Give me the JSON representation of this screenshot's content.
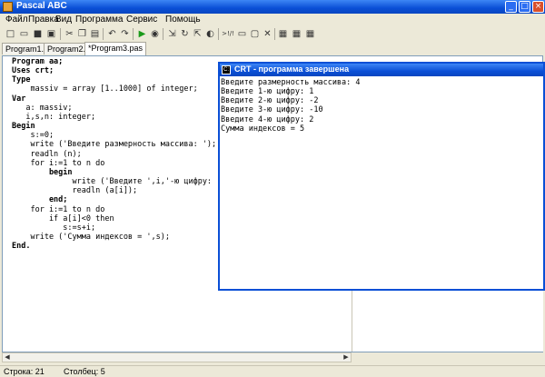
{
  "app": {
    "title": "Pascal ABC",
    "minimize": "_",
    "maximize": "□",
    "close": "×"
  },
  "menu": [
    "Файл",
    "Правка",
    "Вид",
    "Программа",
    "Сервис",
    "Помощь"
  ],
  "toolbar": {
    "icons": [
      "new-file-icon",
      "open-folder-icon",
      "save-icon",
      "save-all-icon",
      "cut-icon",
      "copy-icon",
      "paste-icon",
      "undo-icon",
      "redo-icon",
      "run-icon",
      "stop-icon",
      "step-into-icon",
      "step-over-icon",
      "step-out-icon",
      "breakpoint-icon",
      "goto-line-icon",
      "watch-icon",
      "window-icon",
      "clear-icon",
      "compile-icon",
      "compile-all-icon",
      "options-icon"
    ],
    "goto_label": ">!/!"
  },
  "tabs": [
    "Program1.pas",
    "Program2.pas",
    "*Program3.pas"
  ],
  "code_lines": [
    "Program aa;",
    "Uses crt;",
    "Type",
    "    massiv = array [1..1000] of integer;",
    "Var",
    "   a: massiv;",
    "   i,s,n: integer;",
    "Begin",
    "    s:=0;",
    "    write ('Введите размерность массива: ');",
    "    readln (n);",
    "    for i:=1 to n do",
    "        begin",
    "             write ('Введите ',i,'-ю цифру: ');",
    "             readln (a[i]);",
    "        end;",
    "    for i:=1 to n do",
    "        if a[i]<0 then",
    "           s:=s+i;",
    "    write ('Сумма индексов = ',s);",
    "End."
  ],
  "crt": {
    "title": "CRT - программа завершена",
    "output": [
      "Введите размерность массива: 4",
      "Введите 1-ю цифру: 1",
      "Введите 2-ю цифру: -2",
      "Введите 3-ю цифру: -10",
      "Введите 4-ю цифру: 2",
      "Сумма индексов = 5"
    ]
  },
  "status": {
    "line": "Строка: 21",
    "column": "Столбец: 5"
  }
}
